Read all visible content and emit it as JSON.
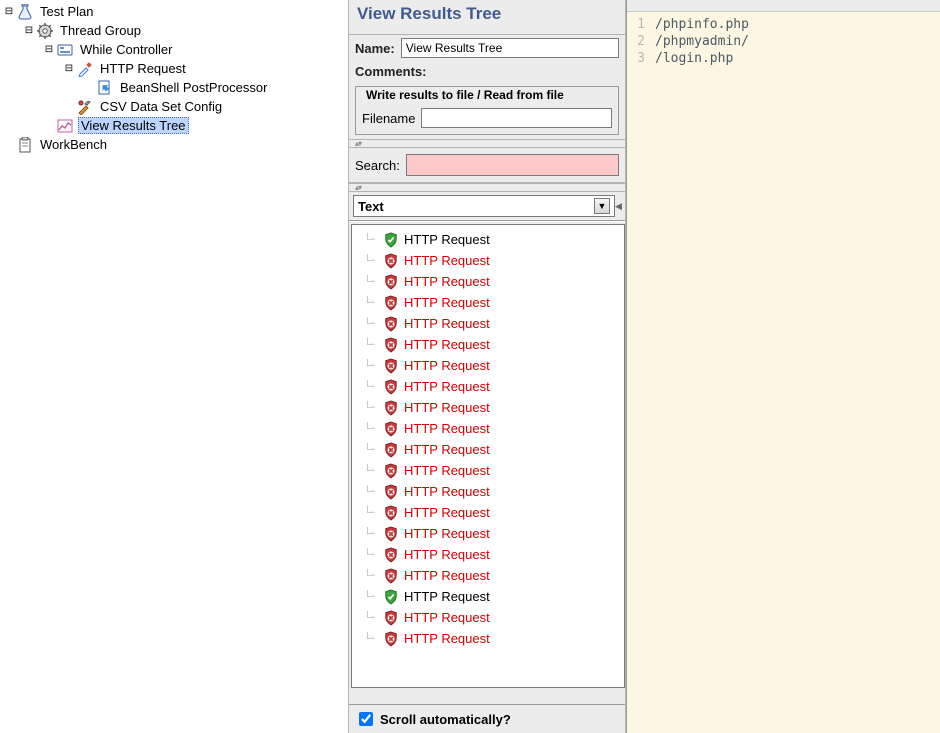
{
  "tree": {
    "test_plan": "Test Plan",
    "thread_group": "Thread Group",
    "while_controller": "While Controller",
    "http_request": "HTTP Request",
    "beanshell_pp": "BeanShell PostProcessor",
    "csv_config": "CSV Data Set Config",
    "view_results_tree": "View Results Tree",
    "workbench": "WorkBench"
  },
  "panel": {
    "title": "View Results Tree",
    "name_label": "Name:",
    "name_value": "View Results Tree",
    "comments_label": "Comments:",
    "writebox_title": "Write results to file / Read from file",
    "filename_label": "Filename",
    "filename_value": "",
    "search_label": "Search:",
    "search_value": "",
    "combo_value": "Text",
    "scroll_label": "Scroll automatically?",
    "scroll_checked": true
  },
  "results": [
    {
      "status": "ok",
      "label": "HTTP Request"
    },
    {
      "status": "err",
      "label": "HTTP Request"
    },
    {
      "status": "err",
      "label": "HTTP Request"
    },
    {
      "status": "err",
      "label": "HTTP Request"
    },
    {
      "status": "err",
      "label": "HTTP Request"
    },
    {
      "status": "err",
      "label": "HTTP Request"
    },
    {
      "status": "err",
      "label": "HTTP Request"
    },
    {
      "status": "err",
      "label": "HTTP Request"
    },
    {
      "status": "err",
      "label": "HTTP Request"
    },
    {
      "status": "err",
      "label": "HTTP Request"
    },
    {
      "status": "err",
      "label": "HTTP Request"
    },
    {
      "status": "err",
      "label": "HTTP Request"
    },
    {
      "status": "err",
      "label": "HTTP Request"
    },
    {
      "status": "err",
      "label": "HTTP Request"
    },
    {
      "status": "err",
      "label": "HTTP Request"
    },
    {
      "status": "err",
      "label": "HTTP Request"
    },
    {
      "status": "err",
      "label": "HTTP Request"
    },
    {
      "status": "ok",
      "label": "HTTP Request"
    },
    {
      "status": "err",
      "label": "HTTP Request"
    },
    {
      "status": "err",
      "label": "HTTP Request"
    }
  ],
  "editor": {
    "lines": [
      "/phpinfo.php",
      "/phpmyadmin/",
      "/login.php"
    ]
  }
}
